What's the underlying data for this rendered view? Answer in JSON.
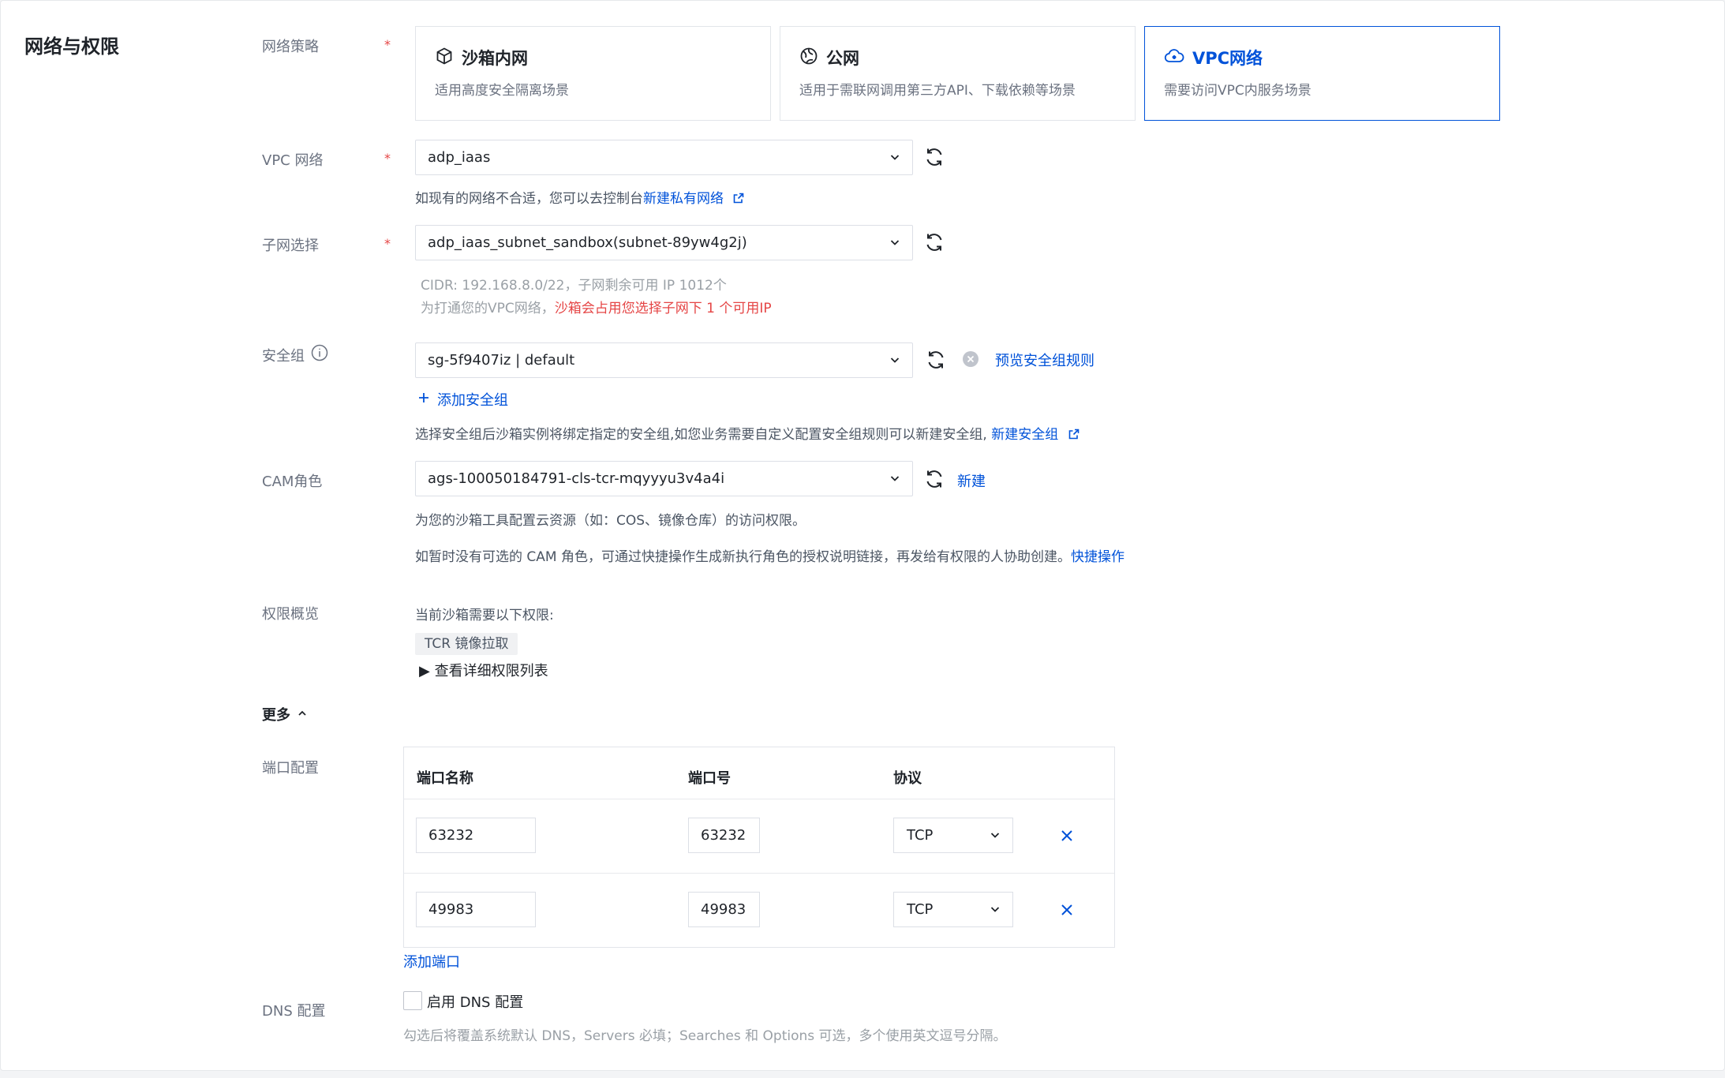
{
  "section_title": "网络与权限",
  "labels": {
    "network_policy": "网络策略",
    "vpc": "VPC 网络",
    "subnet": "子网选择",
    "security_group": "安全组",
    "cam_role": "CAM角色",
    "permissions": "权限概览",
    "more": "更多",
    "port_config": "端口配置",
    "dns_config": "DNS 配置"
  },
  "required_mark": "*",
  "network_options": [
    {
      "title": "沙箱内网",
      "desc": "适用高度安全隔离场景",
      "icon": "cube-icon",
      "selected": false
    },
    {
      "title": "公网",
      "desc": "适用于需联网调用第三方API、下载依赖等场景",
      "icon": "globe-icon",
      "selected": false
    },
    {
      "title": "VPC网络",
      "desc": "需要访问VPC内服务场景",
      "icon": "cloud-icon",
      "selected": true
    }
  ],
  "vpc": {
    "value": "adp_iaas",
    "hint_prefix": "如现有的网络不合适，您可以去控制台",
    "hint_link": "新建私有网络"
  },
  "subnet": {
    "value": "adp_iaas_subnet_sandbox(subnet-89yw4g2j)",
    "cidr_line": "CIDR: 192.168.8.0/22，子网剩余可用 IP 1012个",
    "warn_prefix": "为打通您的VPC网络，",
    "warn_red": "沙箱会占用您选择子网下 1 个可用IP"
  },
  "security_group": {
    "value": "sg-5f9407iz | default",
    "preview_link": "预览安全组规则",
    "add_label": "添加安全组",
    "hint_prefix": "选择安全组后沙箱实例将绑定指定的安全组,如您业务需要自定义配置安全组规则可以新建安全组,",
    "hint_link": "新建安全组"
  },
  "cam_role": {
    "value": "ags-100050184791-cls-tcr-mqyyyu3v4a4i",
    "new_link": "新建",
    "hint1": "为您的沙箱工具配置云资源（如：COS、镜像仓库）的访问权限。",
    "hint2_prefix": "如暂时没有可选的 CAM 角色，可通过快捷操作生成新执行角色的授权说明链接，再发给有权限的人协助创建。",
    "hint2_link": "快捷操作"
  },
  "permissions": {
    "intro": "当前沙箱需要以下权限:",
    "tag": "TCR 镜像拉取",
    "details_toggle": "▶ 查看详细权限列表"
  },
  "ports": {
    "headers": [
      "端口名称",
      "端口号",
      "协议"
    ],
    "rows": [
      {
        "name": "63232",
        "port": "63232",
        "protocol": "TCP"
      },
      {
        "name": "49983",
        "port": "49983",
        "protocol": "TCP"
      }
    ],
    "add_label": "添加端口"
  },
  "dns": {
    "checkbox_label": "启用 DNS 配置",
    "hint": "勾选后将覆盖系统默认 DNS，Servers 必填；Searches 和 Options 可选，多个使用英文逗号分隔。",
    "checked": false
  },
  "colors": {
    "primary": "#0052d9",
    "required": "#e54545",
    "border": "#dcdfe6"
  }
}
